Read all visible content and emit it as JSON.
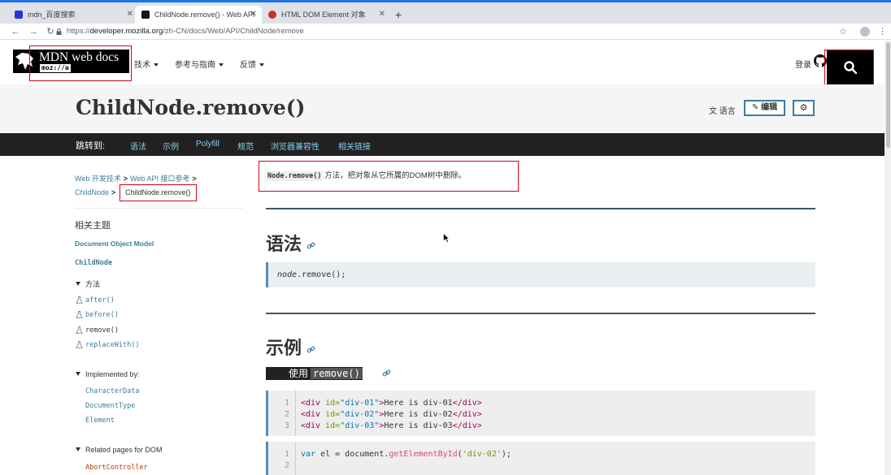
{
  "browser": {
    "tabs": [
      {
        "title": "mdn_百度搜索",
        "active": false
      },
      {
        "title": "ChildNode.remove() - Web API",
        "active": true
      },
      {
        "title": "HTML DOM Element 对象",
        "active": false
      }
    ],
    "new_tab": "+",
    "url_scheme": "https://",
    "url_host": "developer.mozilla.org",
    "url_path": "/zh-CN/docs/Web/API/ChildNode/remove"
  },
  "header": {
    "logo_text": "MDN web docs",
    "logo_sub": "moz://a",
    "nav": [
      {
        "label": "技术"
      },
      {
        "label": "参考与指南"
      },
      {
        "label": "反馈"
      }
    ],
    "login": "登录"
  },
  "title_band": {
    "title": "ChildNode.remove()",
    "language": "语言",
    "edit": "编辑"
  },
  "jumpbar": {
    "label": "跳转到:",
    "links": [
      "语法",
      "示例",
      "Polyfill",
      "规范",
      "浏览器兼容性",
      "相关链接"
    ]
  },
  "sidebar": {
    "crumbs": [
      "Web 开发技术",
      "Web API 接口参考",
      "ChildNode"
    ],
    "crumb_current": "ChildNode.remove()",
    "related_title": "相关主题",
    "dom_link": "Document Object Model",
    "childnode_link": "ChildNode",
    "methods_section": "方法",
    "methods": [
      "after()",
      "before()",
      "remove()",
      "replaceWith()"
    ],
    "implemented_section": "Implemented by:",
    "implemented": [
      "CharacterData",
      "DocumentType",
      "Element"
    ],
    "related_section": "Related pages for DOM",
    "related": [
      "AbortController"
    ]
  },
  "content": {
    "summary_code": "Node.remove()",
    "summary_text": " 方法，把对象从它所属的DOM树中删除。",
    "syntax_heading": "语法",
    "syntax_obj": "node",
    "syntax_rest": ".remove();",
    "examples_heading": "示例",
    "example_sub_prefix": "使用",
    "example_sub_code": "remove()",
    "code1": [
      {
        "num": "1",
        "open": "<div",
        "attr": " id=",
        "val": "\"div-01\"",
        "close": ">",
        "text": "Here is div-01",
        "end": "</div>"
      },
      {
        "num": "2",
        "open": "<div",
        "attr": " id=",
        "val": "\"div-02\"",
        "close": ">",
        "text": "Here is div-02",
        "end": "</div>"
      },
      {
        "num": "3",
        "open": "<div",
        "attr": " id=",
        "val": "\"div-03\"",
        "close": ">",
        "text": "Here is div-03",
        "end": "</div>"
      }
    ],
    "code2": [
      {
        "num": "1",
        "kw": "var",
        "a": " el = document.",
        "fn": "getElementById",
        "b": "(",
        "str": "'div-02'",
        "c": ");"
      },
      {
        "num": "2",
        "kw": "",
        "a": "",
        "fn": "",
        "b": "",
        "str": "",
        "c": ""
      }
    ]
  },
  "colors": {
    "accent": "#3d7e9a",
    "highlight_box": "#d0021b",
    "jumpbar_bg": "#212121"
  }
}
